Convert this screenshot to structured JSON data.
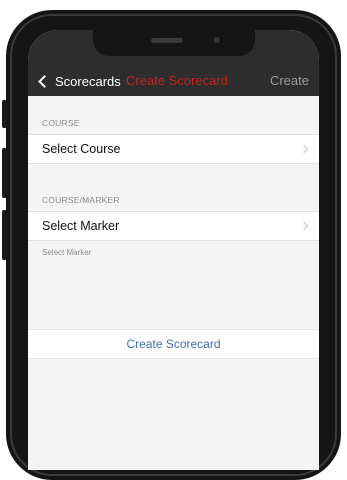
{
  "navbar": {
    "back_label": "Scorecards",
    "title": "Create Scorecard",
    "action_label": "Create"
  },
  "course_section": {
    "header": "COURSE",
    "row_label": "Select Course"
  },
  "marker_section": {
    "header": "COURSE/MARKER",
    "row_label": "Select Marker",
    "footnote": "Select Marker"
  },
  "create_button_label": "Create Scorecard",
  "colors": {
    "title": "#c0261e",
    "link": "#3d6fb5",
    "navbar": "#2d2d2d"
  }
}
